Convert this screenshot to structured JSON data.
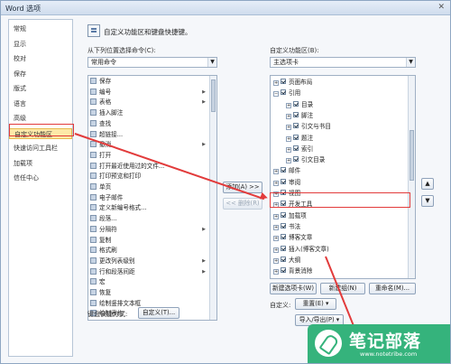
{
  "window": {
    "title": "Word 选项",
    "close_glyph": "✕"
  },
  "sidebar": {
    "items": [
      {
        "label": "常规"
      },
      {
        "label": "显示"
      },
      {
        "label": "校对"
      },
      {
        "label": "保存"
      },
      {
        "label": "版式"
      },
      {
        "label": "语言"
      },
      {
        "label": "高级"
      },
      {
        "label": "自定义功能区",
        "active": true
      },
      {
        "label": "快速访问工具栏"
      },
      {
        "label": "加载项"
      },
      {
        "label": "信任中心"
      }
    ]
  },
  "header": {
    "text": "自定义功能区和键盘快捷键。",
    "icon": "ribbon-customize-icon"
  },
  "left_pane": {
    "label": "从下列位置选择命令(C):",
    "combo_value": "常用命令",
    "commands": [
      {
        "label": "保存",
        "icon": "save-icon"
      },
      {
        "label": "编号",
        "icon": "numbering-icon",
        "submenu": true
      },
      {
        "label": "表格",
        "icon": "table-icon",
        "submenu": true
      },
      {
        "label": "插入脚注",
        "icon": "footnote-icon"
      },
      {
        "label": "查找",
        "icon": "find-icon"
      },
      {
        "label": "超链接...",
        "icon": "hyperlink-icon"
      },
      {
        "label": "撤消",
        "icon": "undo-icon",
        "submenu": true
      },
      {
        "label": "打开",
        "icon": "open-icon"
      },
      {
        "label": "打开最近使用过的文件...",
        "icon": "recent-file-icon"
      },
      {
        "label": "打印预览和打印",
        "icon": "print-preview-icon"
      },
      {
        "label": "单页",
        "icon": "single-page-icon"
      },
      {
        "label": "电子邮件",
        "icon": "email-icon"
      },
      {
        "label": "定义新编号格式...",
        "icon": "number-format-icon"
      },
      {
        "label": "段落...",
        "icon": "paragraph-icon"
      },
      {
        "label": "分隔符",
        "icon": "separator-icon",
        "submenu": true
      },
      {
        "label": "复制",
        "icon": "copy-icon"
      },
      {
        "label": "格式刷",
        "icon": "format-painter-icon"
      },
      {
        "label": "更改列表级别",
        "icon": "list-level-icon",
        "submenu": true
      },
      {
        "label": "行和段落间距",
        "icon": "line-spacing-icon",
        "submenu": true
      },
      {
        "label": "宏",
        "icon": "macro-icon"
      },
      {
        "label": "恢复",
        "icon": "redo-icon"
      },
      {
        "label": "绘制竖排文本框",
        "icon": "vertical-textbox-icon"
      },
      {
        "label": "绘制表格",
        "icon": "draw-table-icon"
      }
    ]
  },
  "middle_buttons": {
    "add": "添加(A) >>",
    "remove": "<< 删除(R)"
  },
  "right_pane": {
    "label": "自定义功能区(B):",
    "combo_value": "主选项卡",
    "tree": [
      {
        "label": "页面布局",
        "level": 0,
        "expand": "+"
      },
      {
        "label": "引用",
        "level": 0,
        "expand": "−"
      },
      {
        "label": "目录",
        "level": 1,
        "expand": "+"
      },
      {
        "label": "脚注",
        "level": 1,
        "expand": "+"
      },
      {
        "label": "引文与书目",
        "level": 1,
        "expand": "+"
      },
      {
        "label": "题注",
        "level": 1,
        "expand": "+"
      },
      {
        "label": "索引",
        "level": 1,
        "expand": "+"
      },
      {
        "label": "引文目录",
        "level": 1,
        "expand": "+"
      },
      {
        "label": "邮件",
        "level": 0,
        "expand": "+"
      },
      {
        "label": "审阅",
        "level": 0,
        "expand": "+"
      },
      {
        "label": "视图",
        "level": 0,
        "expand": "+"
      },
      {
        "label": "开发工具",
        "level": 0,
        "expand": "+",
        "highlight": true
      },
      {
        "label": "加载项",
        "level": 0,
        "expand": "+"
      },
      {
        "label": "书法",
        "level": 0,
        "expand": "+"
      },
      {
        "label": "博客文章",
        "level": 0,
        "expand": "+"
      },
      {
        "label": "插入(博客文章)",
        "level": 0,
        "expand": "+"
      },
      {
        "label": "大纲",
        "level": 0,
        "expand": "+"
      },
      {
        "label": "背景消除",
        "level": 0,
        "expand": "+"
      }
    ],
    "buttons": {
      "new_tab": "新建选项卡(W)",
      "new_group": "新建组(N)",
      "rename": "重命名(M)..."
    },
    "customize_label": "自定义:",
    "reset": "重置(E) ▾",
    "import_export": "导入/导出(P) ▾"
  },
  "keyboard": {
    "label": "键盘快捷方式:",
    "button": "自定义(T)..."
  },
  "watermark": {
    "title": "笔记部落",
    "url": "www.notetribe.com"
  },
  "colors": {
    "highlight": "#e23b3b",
    "selected": "#fde9a8",
    "brand": "#35b37c"
  }
}
